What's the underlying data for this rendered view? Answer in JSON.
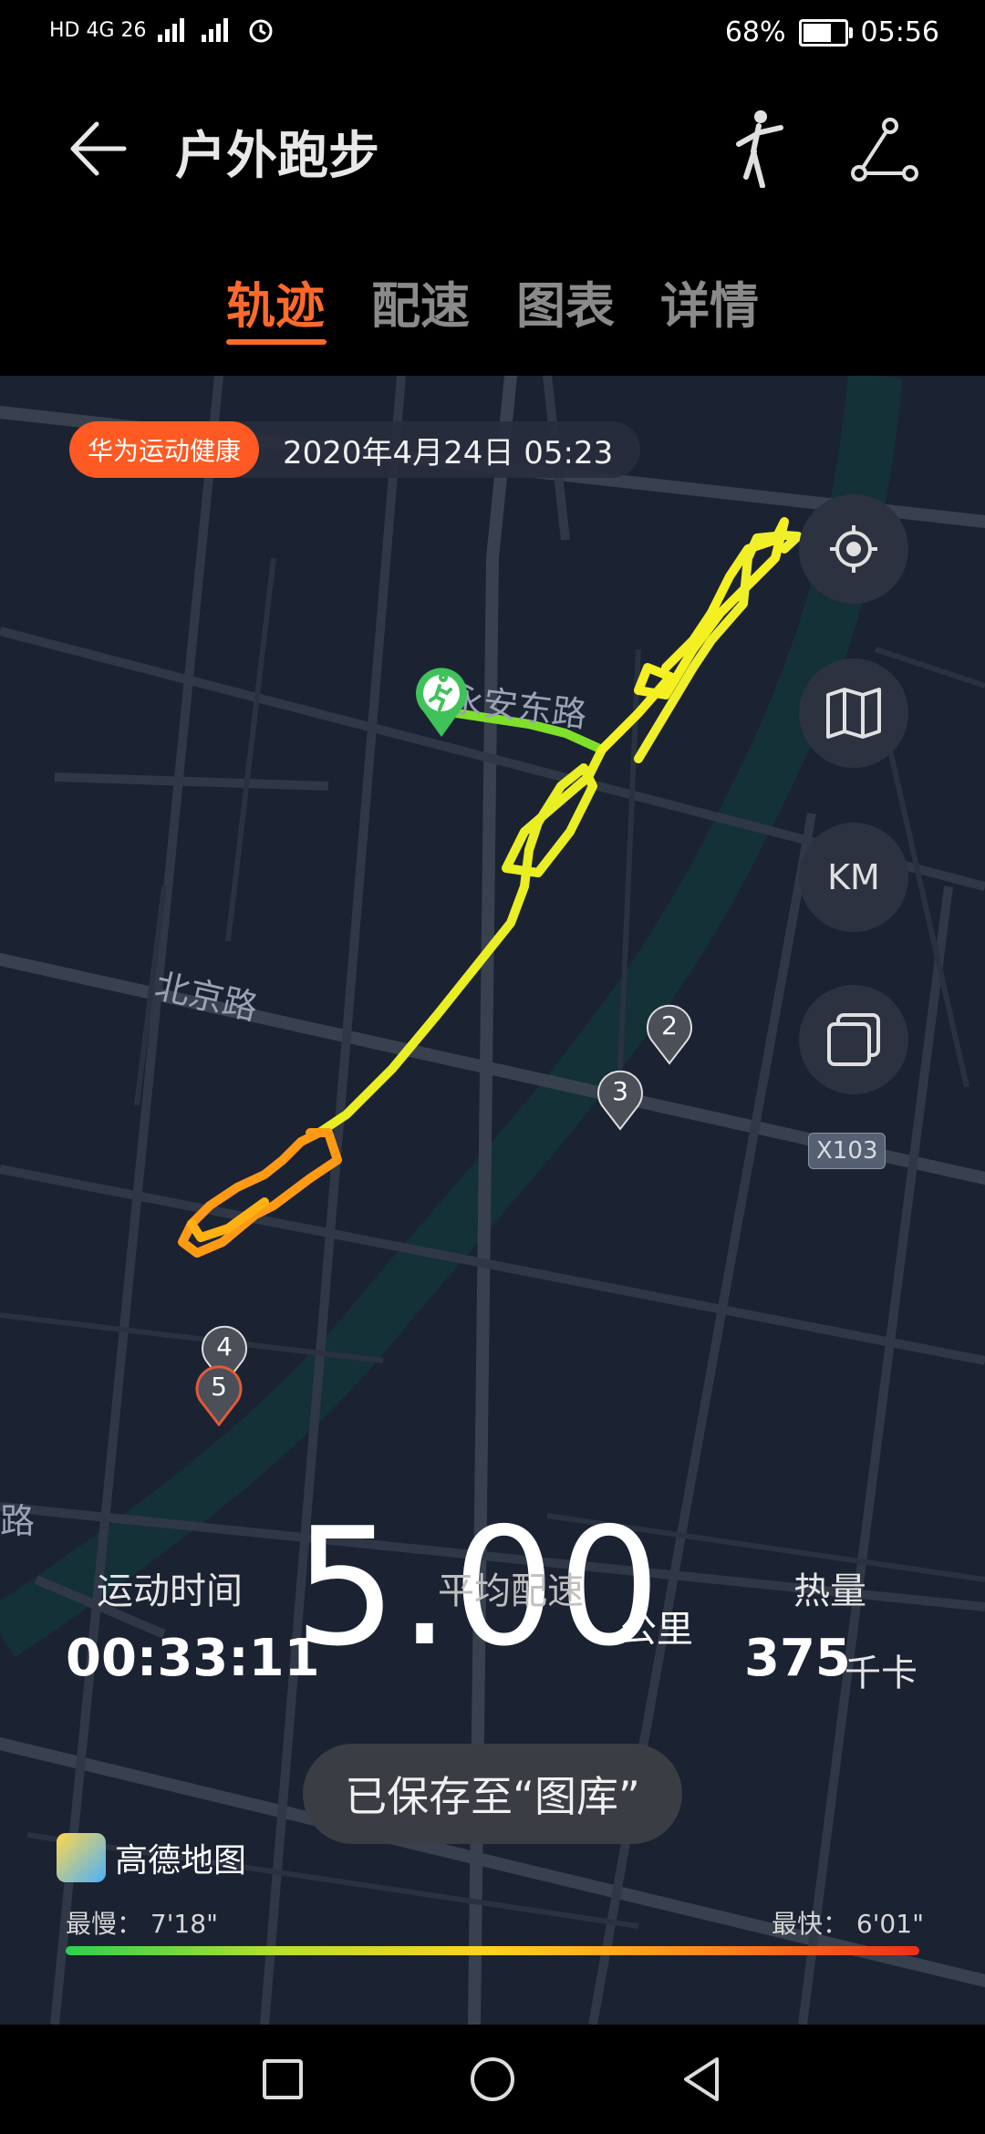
{
  "status_bar": {
    "signal_left": "HD 4G 26",
    "battery": "68%",
    "time": "05:56",
    "battery_level": 0.68
  },
  "header": {
    "title": "户外跑步",
    "tabs": [
      "轨迹",
      "配速",
      "图表",
      "详情"
    ],
    "active_tab": 0
  },
  "map": {
    "source_badge": "华为运动健康",
    "date": "2020年4月24日 05:23",
    "road_labels": {
      "yongan": "永安东路",
      "beijing": "北京路",
      "edge": "路"
    },
    "road_tag": "X103",
    "km_button": "KM",
    "markers": [
      "2",
      "3",
      "4",
      "5"
    ]
  },
  "summary": {
    "distance": "5.00",
    "distance_unit": "公里",
    "time_label": "运动时间",
    "time_value": "00:33:11",
    "pace_label": "平均配速",
    "calorie_label": "热量",
    "calorie_value": "375",
    "calorie_unit": "千卡"
  },
  "toast": "已保存至“图库”",
  "map_provider": "高德地图",
  "pace_scale": {
    "slow_label": "最慢：",
    "slow_value": "7'18\"",
    "fast_label": "最快：",
    "fast_value": "6'01\""
  },
  "colors": {
    "accent": "#ff6a2a",
    "map_bg": "#1b2232",
    "route_green": "#7ee02a",
    "route_yellow": "#f4f022",
    "route_orange": "#ff9a14"
  }
}
